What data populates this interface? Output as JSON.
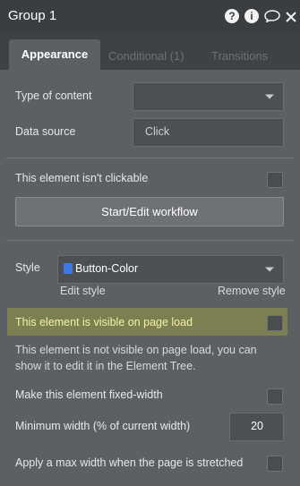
{
  "header": {
    "title": "Group 1",
    "icons": [
      "help-icon",
      "info-icon",
      "comment-icon",
      "close-icon"
    ]
  },
  "tabs": {
    "appearance": "Appearance",
    "conditional": "Conditional (1)",
    "transitions": "Transitions"
  },
  "fields": {
    "type_of_content_label": "Type of content",
    "type_of_content_value": "",
    "data_source_label": "Data source",
    "data_source_value": "Click"
  },
  "clickable": {
    "label": "This element isn't clickable"
  },
  "workflow": {
    "button_label": "Start/Edit workflow"
  },
  "style": {
    "label": "Style",
    "value": "Button-Color",
    "edit_label": "Edit style",
    "remove_label": "Remove style"
  },
  "visibility": {
    "label": "This element is visible on page load",
    "note": "This element is not visible on page load, you can show it to edit it in the Element Tree."
  },
  "layout": {
    "fixed_width_label": "Make this element fixed-width",
    "min_width_label": "Minimum width (% of current width)",
    "min_width_value": "20",
    "max_width_label": "Apply a max width when the page is stretched"
  }
}
